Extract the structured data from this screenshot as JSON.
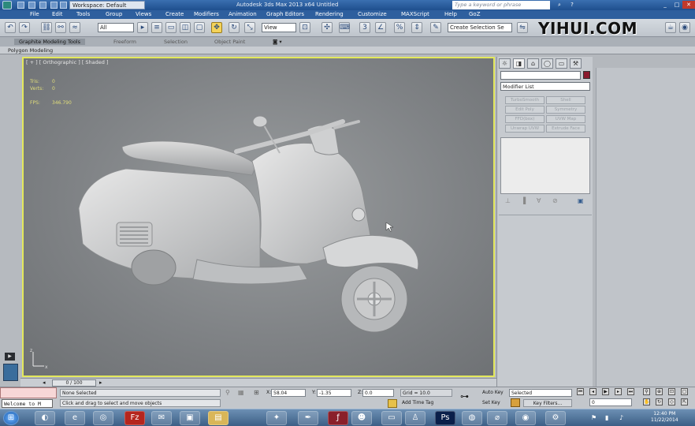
{
  "titlebar": {
    "workspace": "Workspace: Default",
    "title": "Autodesk 3ds Max 2013 x64       Untitled",
    "search_placeholder": "Type a keyword or phrase"
  },
  "menu": [
    "File",
    "Edit",
    "Tools",
    "Group",
    "Views",
    "Create",
    "Modifiers",
    "Animation",
    "Graph Editors",
    "Rendering",
    "Customize",
    "MAXScript",
    "Help",
    "GoZ"
  ],
  "toolbar": {
    "selection_filter": "All",
    "reference_coord": "View",
    "named_selection": "Create Selection Se"
  },
  "watermark": "YIHUI.COM",
  "ribbon": {
    "tabs": [
      "Graphite Modeling Tools",
      "Freeform",
      "Selection",
      "Object Paint"
    ],
    "panel_label": "Polygon Modeling"
  },
  "viewport": {
    "label": "[ + ] [ Orthographic ] [ Shaded ]",
    "tris_label": "Tris:",
    "tris_value": "0",
    "verts_label": "Verts:",
    "verts_value": "0",
    "fps_label": "FPS:",
    "fps_value": "346.790"
  },
  "command_panel": {
    "modifier_list": "Modifier List",
    "buttons": [
      "TurboSmooth",
      "Shell",
      "Edit Poly",
      "Symmetry",
      "FFD(box)",
      "UVW Map",
      "Unwrap UVW",
      "Extrude Face"
    ],
    "swatch_color": "#8b1a2e"
  },
  "timeline": {
    "frame": "0 / 100"
  },
  "status": {
    "selection": "None Selected",
    "prompt": "Click and drag to select and move objects",
    "x_label": "X:",
    "x_value": "58.04",
    "y_label": "Y:",
    "y_value": "-1.35",
    "z_label": "Z:",
    "z_value": "0.0",
    "grid": "Grid = 10.0",
    "add_time_tag": "Add Time Tag",
    "auto_key": "Auto Key",
    "set_key": "Set Key",
    "key_filter_value": "Selected",
    "key_filters": "Key Filters...",
    "frame_field": "0",
    "welcome": "Welcome to M"
  },
  "taskbar": {
    "time": "12:40 PM",
    "date": "11/22/2014"
  }
}
